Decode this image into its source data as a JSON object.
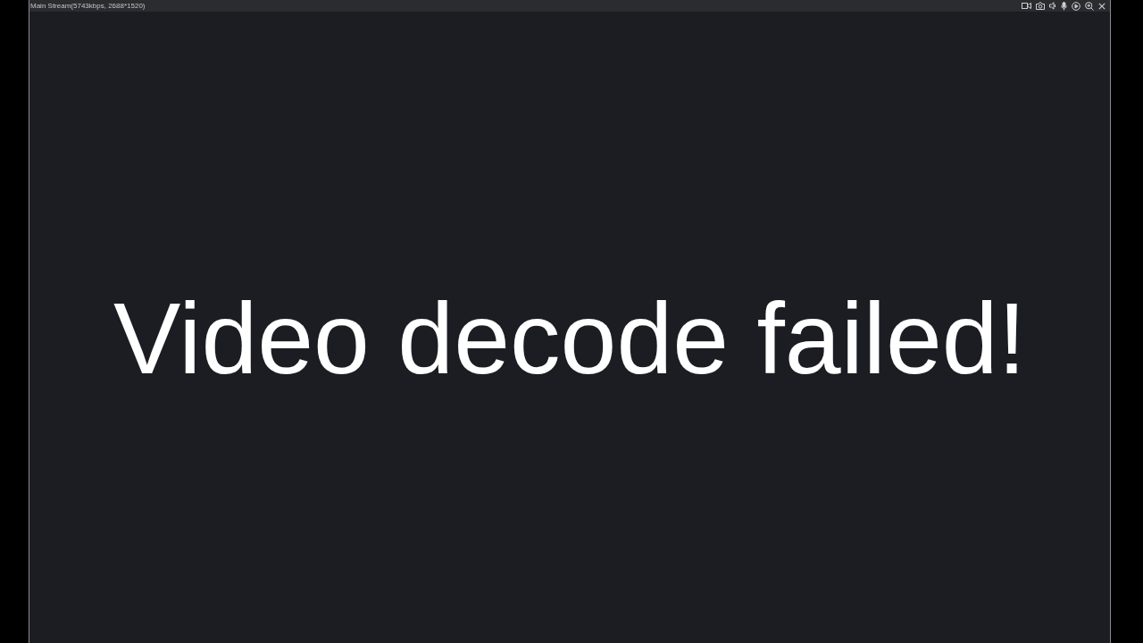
{
  "window": {
    "title": "Main Stream(5743kbps, 2688*1520)"
  },
  "video": {
    "message": "Video decode failed!"
  }
}
